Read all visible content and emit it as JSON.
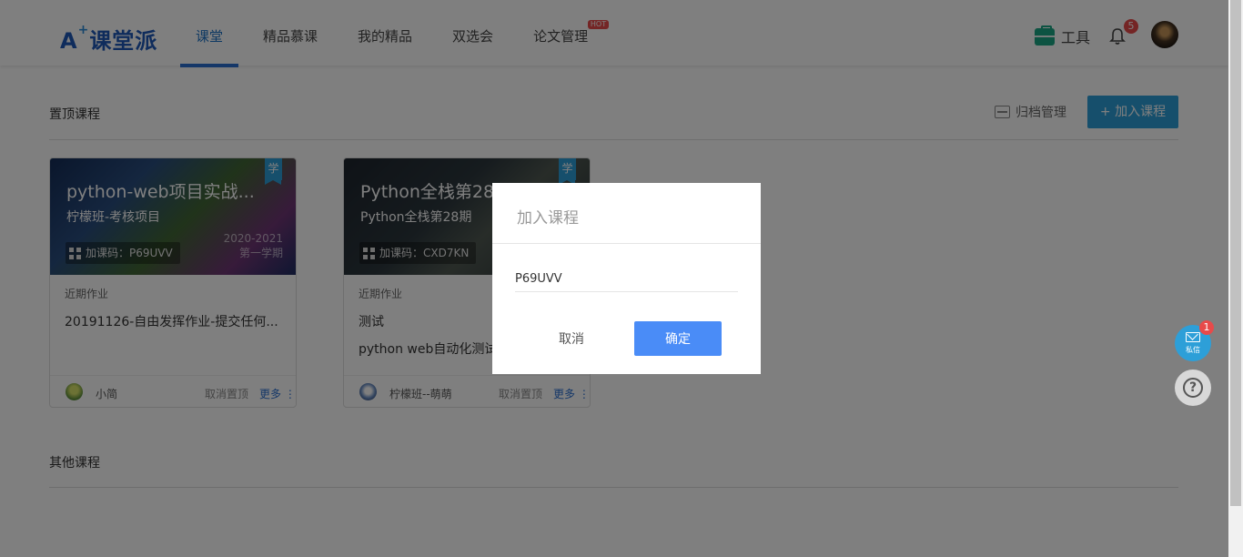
{
  "header": {
    "logo_mark": "A",
    "logo_text": "课堂派",
    "nav": [
      {
        "label": "课堂"
      },
      {
        "label": "精品慕课"
      },
      {
        "label": "我的精品"
      },
      {
        "label": "双选会"
      },
      {
        "label": "论文管理"
      }
    ],
    "hot_badge": "HOT",
    "tools_label": "工具",
    "notification_count": "5",
    "colors": {
      "active_nav": "#1d72c6",
      "tool_icon": "#1ba784",
      "badge": "#e84a4a"
    }
  },
  "pinned": {
    "title": "置顶课程",
    "archive_label": "归档管理",
    "join_label": "+ 加入课程",
    "courses": [
      {
        "title": "python-web项目实战...",
        "subtitle": "柠檬班-考核项目",
        "code": "加课码：P69UVV",
        "term_year": "2020-2021",
        "term": "第一学期",
        "tag": "学",
        "recent_label": "近期作业",
        "homework": [
          "20191126-自由发挥作业-提交任何..."
        ],
        "teacher": "小简",
        "unpin": "取消置顶",
        "more": "更多"
      },
      {
        "title": "Python全栈第28期",
        "subtitle": "Python全栈第28期",
        "code": "加课码：CXD7KN",
        "term_year": "",
        "term": "",
        "tag": "学",
        "recent_label": "近期作业",
        "homework": [
          "测试",
          "python web自动化测试"
        ],
        "teacher": "柠檬班--萌萌",
        "unpin": "取消置顶",
        "more": "更多"
      }
    ]
  },
  "other": {
    "title": "其他课程"
  },
  "float": {
    "msg_label": "私信",
    "msg_count": "1",
    "help": "?"
  },
  "modal": {
    "title": "加入课程",
    "input_value": "P69UVV",
    "cancel": "取消",
    "confirm": "确定",
    "confirm_color": "#4a8cf7"
  }
}
